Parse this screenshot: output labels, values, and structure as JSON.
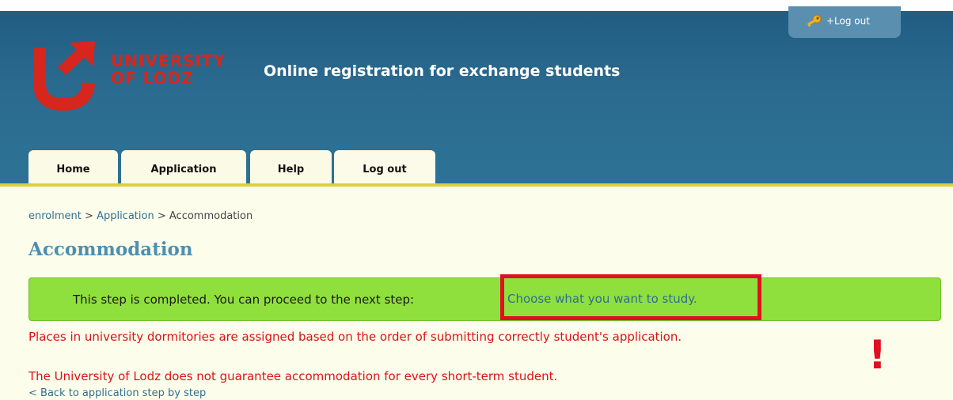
{
  "header": {
    "site_title": "Online registration for exchange students",
    "logo_line1": "UNIVERSITY",
    "logo_line2": "OF LODZ",
    "logout_label": "+Log out",
    "brand_color": "#d7261e"
  },
  "tabs": [
    {
      "label": "Home"
    },
    {
      "label": "Application"
    },
    {
      "label": "Help"
    },
    {
      "label": "Log out"
    }
  ],
  "breadcrumb": {
    "items": [
      "enrolment",
      "Application",
      "Accommodation"
    ],
    "separator": ">"
  },
  "page": {
    "title": "Accommodation",
    "notice_text": "This step is completed. You can proceed to the next step:",
    "notice_link": "Choose what you want to study.",
    "warning1": "Places in university dormitories are assigned based on the order of submitting correctly student's application.",
    "warning2": "The University of Lodz does not guarantee accommodation for every short-term student.",
    "exclamation": "!",
    "back_link": "< Back to application step by step"
  },
  "icons": {
    "logout": "key-icon",
    "logo": "university-logo-icon"
  }
}
